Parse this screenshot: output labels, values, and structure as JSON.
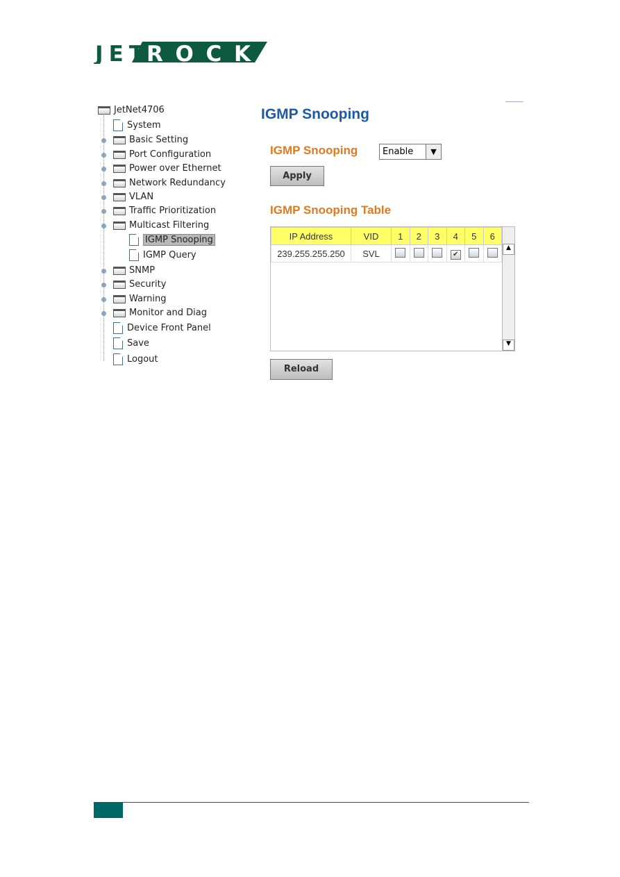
{
  "brand": {
    "logo_text": "JETROCK",
    "color": "#0d5a40"
  },
  "tree": {
    "root": "JetNet4706",
    "items": [
      {
        "label": "System",
        "type": "doc",
        "level": 1
      },
      {
        "label": "Basic Setting",
        "type": "folder",
        "level": 1
      },
      {
        "label": "Port Configuration",
        "type": "folder",
        "level": 1
      },
      {
        "label": "Power over Ethernet",
        "type": "folder",
        "level": 1
      },
      {
        "label": "Network Redundancy",
        "type": "folder",
        "level": 1
      },
      {
        "label": "VLAN",
        "type": "folder",
        "level": 1
      },
      {
        "label": "Traffic Prioritization",
        "type": "folder",
        "level": 1
      },
      {
        "label": "Multicast Filtering",
        "type": "folder",
        "level": 1,
        "expanded": true
      },
      {
        "label": "IGMP Snooping",
        "type": "doc",
        "level": 2,
        "selected": true
      },
      {
        "label": "IGMP Query",
        "type": "doc",
        "level": 2
      },
      {
        "label": "SNMP",
        "type": "folder",
        "level": 1
      },
      {
        "label": "Security",
        "type": "folder",
        "level": 1
      },
      {
        "label": "Warning",
        "type": "folder",
        "level": 1
      },
      {
        "label": "Monitor and Diag",
        "type": "folder",
        "level": 1
      },
      {
        "label": "Device Front Panel",
        "type": "doc",
        "level": 1
      },
      {
        "label": "Save",
        "type": "doc",
        "level": 1
      },
      {
        "label": "Logout",
        "type": "doc",
        "level": 1
      }
    ]
  },
  "main": {
    "title": "IGMP Snooping",
    "snooping_label": "IGMP Snooping",
    "snooping_value": "Enable",
    "apply": "Apply",
    "table_title": "IGMP Snooping Table",
    "columns": [
      "IP Address",
      "VID",
      "1",
      "2",
      "3",
      "4",
      "5",
      "6"
    ],
    "rows": [
      {
        "ip": "239.255.255.250",
        "vid": "SVL",
        "ports": [
          false,
          false,
          false,
          true,
          false,
          false
        ]
      }
    ],
    "reload": "Reload"
  },
  "colors": {
    "title": "#1c5aa6",
    "section": "#e07a1e",
    "header_bg": "#ffff66",
    "footer": "#006666"
  }
}
